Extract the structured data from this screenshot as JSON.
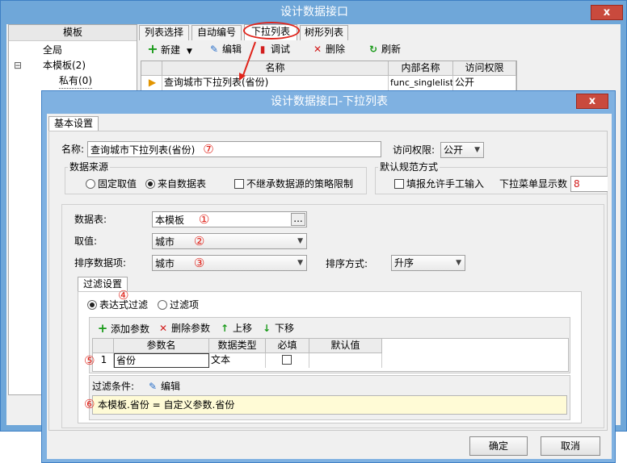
{
  "outer_window": {
    "title": "设计数据接口",
    "close_label": "x"
  },
  "tree": {
    "header": "模板",
    "items": [
      "全局",
      "本模板(2)",
      "私有(0)"
    ],
    "expander": "⊟"
  },
  "tabs": [
    "列表选择",
    "自动编号",
    "下拉列表",
    "树形列表"
  ],
  "toolbar": {
    "new_label": "新建",
    "edit_label": "编辑",
    "debug_label": "调试",
    "delete_label": "删除",
    "refresh_label": "刷新"
  },
  "list_grid": {
    "columns": [
      "名称",
      "内部名称",
      "访问权限"
    ],
    "rows": [
      {
        "name": "查询城市下拉列表(省份)",
        "internal": "func_singlelist5",
        "access": "公开"
      }
    ]
  },
  "dialog": {
    "title": "设计数据接口-下拉列表",
    "close_label": "x",
    "tab": "基本设置",
    "name_label": "名称:",
    "name_value": "查询城市下拉列表(省份)",
    "access_label": "访问权限:",
    "access_value": "公开",
    "source_group": "数据来源",
    "source_fixed": "固定取值",
    "source_table": "来自数据表",
    "no_inherit": "不继承数据源的策略限制",
    "norm_group": "默认规范方式",
    "allow_manual": "填报允许手工输入",
    "dropdown_count_label": "下拉菜单显示数",
    "dropdown_count_value": "8",
    "table_label": "数据表:",
    "table_value": "本模板",
    "browse_label": "...",
    "value_label": "取值:",
    "value_value": "城市",
    "sort_label": "排序数据项:",
    "sort_value": "城市",
    "sort_mode_label": "排序方式:",
    "sort_mode_value": "升序",
    "filter_tab": "过滤设置",
    "filter_expr": "表达式过滤",
    "filter_item": "过滤项",
    "add_param": "添加参数",
    "del_param": "删除参数",
    "move_up": "上移",
    "move_down": "下移",
    "param_columns": [
      "参数名",
      "数据类型",
      "必填",
      "默认值"
    ],
    "param_rows": [
      {
        "index": "1",
        "name": "省份",
        "type": "文本",
        "required": false,
        "default": ""
      }
    ],
    "condition_label": "过滤条件:",
    "condition_edit": "编辑",
    "condition_value": "本模板.省份  =  自定义参数.省份",
    "ok_label": "确定",
    "cancel_label": "取消"
  },
  "markers": {
    "m1": "①",
    "m2": "②",
    "m3": "③",
    "m4": "④",
    "m5": "⑤",
    "m6": "⑥",
    "m7": "⑦"
  },
  "colors": {
    "title_bar": "#6fa7d9",
    "close_button": "#c94a3d",
    "annotation": "#e0241b",
    "condition_bg": "#fffbd6"
  }
}
